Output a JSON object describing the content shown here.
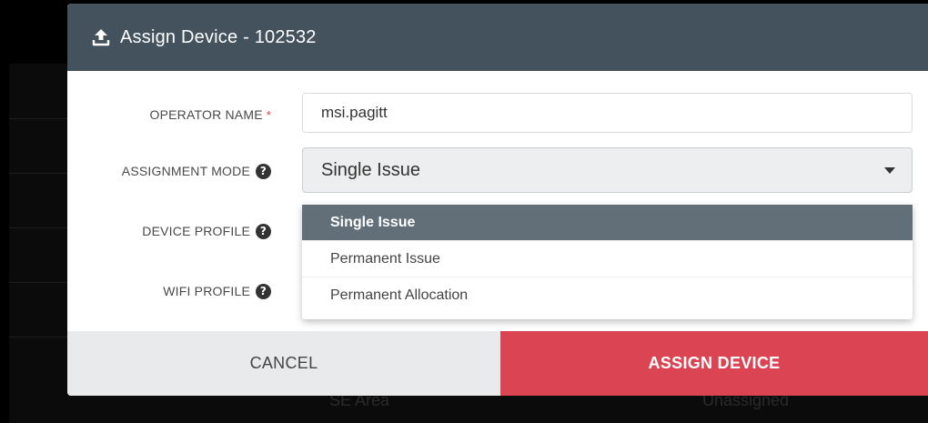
{
  "background": {
    "cells": [
      "SE Area",
      "Unassigned"
    ]
  },
  "modal": {
    "title": "Assign Device - 102532",
    "icon": "upload-icon",
    "fields": {
      "operator_name": {
        "label": "OPERATOR NAME",
        "required_mark": "*",
        "value": "msi.pagitt"
      },
      "assignment_mode": {
        "label": "ASSIGNMENT MODE",
        "value": "Single Issue",
        "help": "?"
      },
      "device_profile": {
        "label": "DEVICE PROFILE",
        "help": "?"
      },
      "wifi_profile": {
        "label": "WIFI PROFILE",
        "help": "?"
      }
    },
    "dropdown_options": [
      "Single Issue",
      "Permanent Issue",
      "Permanent Allocation"
    ],
    "buttons": {
      "cancel": "CANCEL",
      "assign": "ASSIGN DEVICE"
    }
  },
  "colors": {
    "header": "#44525e",
    "accent": "#db4452",
    "selected_option": "#636f78"
  }
}
